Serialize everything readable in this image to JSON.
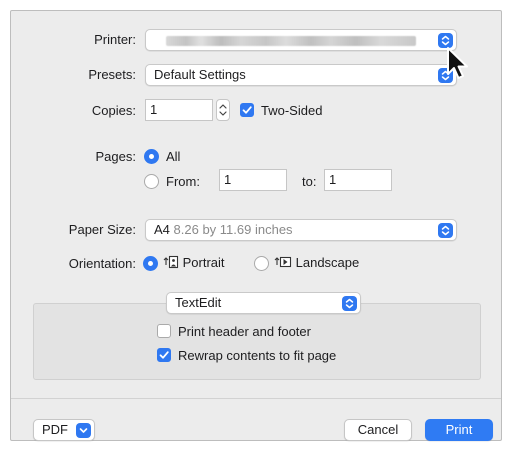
{
  "printer": {
    "label": "Printer:",
    "value": ""
  },
  "presets": {
    "label": "Presets:",
    "value": "Default Settings"
  },
  "copies": {
    "label": "Copies:",
    "value": "1",
    "two_sided_label": "Two-Sided",
    "two_sided_checked": true
  },
  "pages": {
    "label": "Pages:",
    "all_label": "All",
    "from_label": "From:",
    "from_value": "1",
    "to_label": "to:",
    "to_value": "1",
    "selected": "All"
  },
  "paper_size": {
    "label": "Paper Size:",
    "name": "A4",
    "dimensions": "8.26 by 11.69 inches"
  },
  "orientation": {
    "label": "Orientation:",
    "portrait_label": "Portrait",
    "landscape_label": "Landscape",
    "selected": "Portrait"
  },
  "app_section": {
    "value": "TextEdit",
    "print_header_label": "Print header and footer",
    "print_header_checked": false,
    "rewrap_label": "Rewrap contents to fit page",
    "rewrap_checked": true
  },
  "footer": {
    "pdf_label": "PDF",
    "cancel_label": "Cancel",
    "print_label": "Print"
  },
  "colors": {
    "accent": "#2f78f1",
    "dialog_bg": "#ececec"
  },
  "icons": [
    "chevron-updown-icon",
    "stepper-arrows-icon",
    "checkmark-icon",
    "portrait-icon",
    "landscape-icon",
    "chevron-down-icon",
    "mouse-cursor-icon"
  ]
}
